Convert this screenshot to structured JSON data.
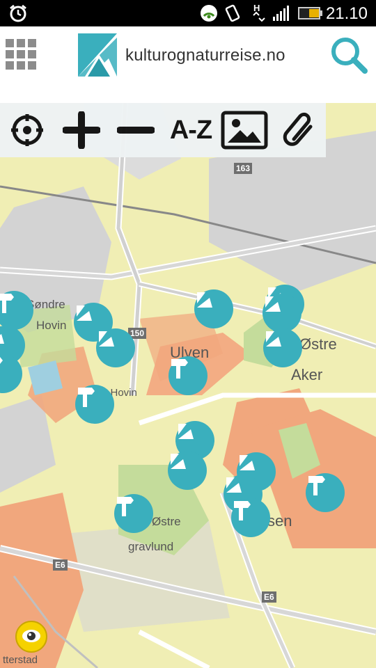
{
  "status_bar": {
    "time": "21.10",
    "icons": [
      "alarm-icon",
      "wifi-icon",
      "vibrate-icon",
      "h-data-icon",
      "signal-icon",
      "battery-icon"
    ]
  },
  "header": {
    "brand": "kulturognaturreise.no",
    "icons": [
      "grid-icon",
      "logo-icon",
      "search-icon"
    ]
  },
  "toolbar": {
    "az_label": "A-Z",
    "icons": [
      "locate-icon",
      "zoom-in-icon",
      "zoom-out-icon",
      "image-icon",
      "link-icon"
    ]
  },
  "map": {
    "labels": {
      "sondre": "Søndre",
      "hovin": "Hovin",
      "ulven": "Ulven",
      "ostre": "Østre",
      "aker": "Aker",
      "e_hovin": "e Hovin",
      "ostre2": "Østre",
      "gravlund": "gravlund",
      "sen": "sen",
      "terstad": "tterstad"
    },
    "road_shields": {
      "r163": "163",
      "r150": "150",
      "e6a": "E6",
      "e6b": "E6"
    },
    "pins": [
      {
        "type": "culture"
      },
      {
        "type": "culture"
      },
      {
        "type": "culture"
      },
      {
        "type": "culture"
      },
      {
        "type": "culture"
      },
      {
        "type": "culture"
      },
      {
        "type": "culture"
      },
      {
        "type": "culture"
      },
      {
        "type": "culture"
      },
      {
        "type": "culture"
      },
      {
        "type": "culture"
      },
      {
        "type": "signpost"
      },
      {
        "type": "signpost"
      },
      {
        "type": "signpost"
      },
      {
        "type": "signpost"
      },
      {
        "type": "signpost"
      },
      {
        "type": "signpost"
      },
      {
        "type": "signpost"
      }
    ]
  },
  "colors": {
    "accent": "#3aafbd",
    "map_base": "#f0eeb4",
    "residential": "#f1a77d",
    "park": "#c4dc9b",
    "industrial": "#d2d2d2"
  }
}
